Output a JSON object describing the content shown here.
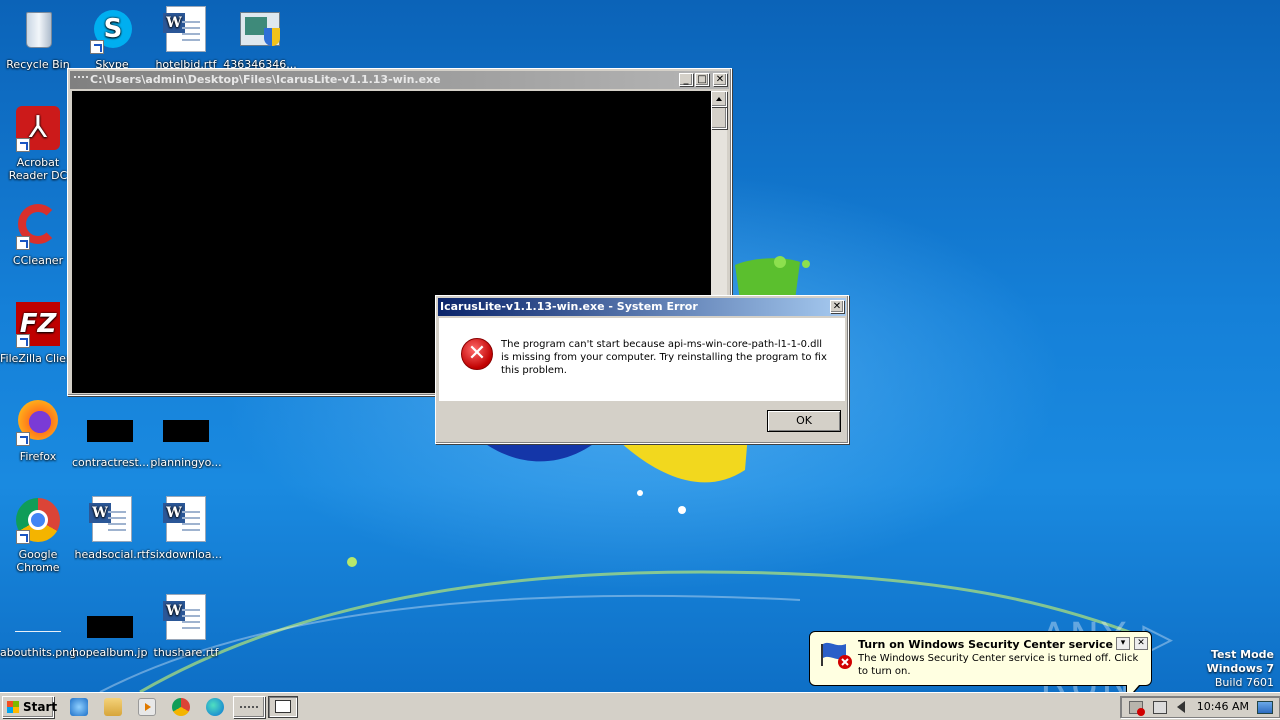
{
  "desktop": {
    "icons": [
      {
        "label": "Recycle Bin",
        "icon": "recycle-bin-icon"
      },
      {
        "label": "Skype",
        "icon": "skype-icon"
      },
      {
        "label": "hotelbid.rtf",
        "icon": "word-document-icon"
      },
      {
        "label": "436346346...",
        "icon": "installer-icon"
      },
      {
        "label": "Acrobat Reader DC",
        "icon": "acrobat-reader-icon"
      },
      {
        "label": "CCleaner",
        "icon": "ccleaner-icon"
      },
      {
        "label": "FileZilla Client",
        "icon": "filezilla-icon"
      },
      {
        "label": "Firefox",
        "icon": "firefox-icon"
      },
      {
        "label": "contractrest...",
        "icon": "image-thumbnail-icon"
      },
      {
        "label": "planningyo...",
        "icon": "image-thumbnail-icon"
      },
      {
        "label": "Google Chrome",
        "icon": "chrome-icon"
      },
      {
        "label": "headsocial.rtf",
        "icon": "word-document-icon"
      },
      {
        "label": "sixdownloa...",
        "icon": "word-document-icon"
      },
      {
        "label": "abouthits.png",
        "icon": "image-thumbnail-icon"
      },
      {
        "label": "hopealbum.jpg",
        "icon": "image-thumbnail-icon"
      },
      {
        "label": "thushare.rtf",
        "icon": "word-document-icon"
      }
    ]
  },
  "console": {
    "title": "C:\\Users\\admin\\Desktop\\Files\\IcarusLite-v1.1.13-win.exe",
    "min": "_",
    "max": "□",
    "close": "✕"
  },
  "dialog": {
    "title": "IcarusLite-v1.1.13-win.exe - System Error",
    "message": "The program can't start because api-ms-win-core-path-l1-1-0.dll is missing from your computer. Try reinstalling the program to fix this problem.",
    "ok_label": "OK",
    "close": "✕",
    "icon": "error-icon"
  },
  "balloon": {
    "title": "Turn on Windows Security Center service",
    "text": "The Windows Security Center service is turned off. Click to turn on.",
    "close": "✕",
    "option": "▾"
  },
  "watermark": "ANY ▷ RUN",
  "test_mode": {
    "line1": "Test Mode",
    "line2": "Windows 7",
    "line3": "Build 7601"
  },
  "taskbar": {
    "start_label": "Start",
    "clock": "10:46 AM"
  },
  "colors": {
    "desktop_blue": "#1580d8",
    "dialog_title": "#0a246a",
    "balloon_bg": "#ffffe1",
    "error_red": "#c00000"
  }
}
